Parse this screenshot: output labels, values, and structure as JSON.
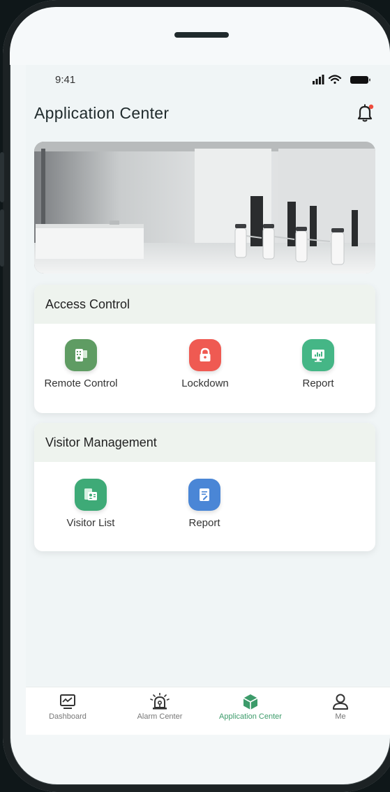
{
  "status_bar": {
    "time": "9:41",
    "icons": [
      "signal-icon",
      "wifi-icon",
      "battery-icon"
    ]
  },
  "header": {
    "title": "Application Center",
    "icon": "bell-icon"
  },
  "banner": {
    "image": "office-lobby-photo"
  },
  "sections": [
    {
      "title": "Access Control",
      "items": [
        {
          "label": "Remote Control",
          "icon": "remote-control-icon",
          "color": "#5f9c63"
        },
        {
          "label": "Lockdown",
          "icon": "lock-icon",
          "color": "#ef5a52"
        },
        {
          "label": "Report",
          "icon": "monitor-chart-icon",
          "color": "#45b686"
        }
      ]
    },
    {
      "title": "Visitor Management",
      "items": [
        {
          "label": "Visitor List",
          "icon": "visitor-card-icon",
          "color": "#3eaa77"
        },
        {
          "label": "Report",
          "icon": "document-edit-icon",
          "color": "#4a86d6"
        }
      ]
    }
  ],
  "bottom_nav": {
    "active": "Application Center",
    "accent": "#3c9b6a",
    "items": [
      {
        "label": "Dashboard",
        "icon": "dashboard-monitor-icon"
      },
      {
        "label": "Alarm Center",
        "icon": "alarm-siren-icon"
      },
      {
        "label": "Application Center",
        "icon": "cube-icon"
      },
      {
        "label": "Me",
        "icon": "user-icon"
      }
    ]
  }
}
